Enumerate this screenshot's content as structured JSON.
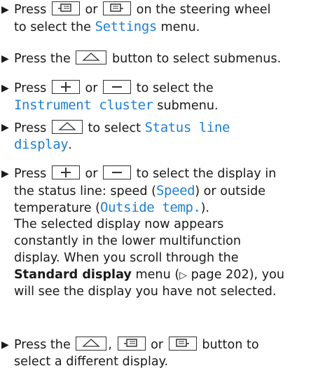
{
  "steps": [
    {
      "lines": [
        [
          "Press ",
          "",
          " or ",
          "",
          " on the steering wheel"
        ],
        [
          "to select the ",
          "Settings",
          " menu."
        ]
      ]
    },
    {
      "lines": [
        [
          "Press the ",
          "",
          " button to select submenus."
        ]
      ]
    },
    {
      "lines": [
        [
          "Press ",
          "",
          " or ",
          "",
          " to select the"
        ],
        [
          "Instrument cluster",
          " submenu."
        ]
      ]
    },
    {
      "lines": [
        [
          "Press ",
          "",
          " to select ",
          "Status line"
        ],
        [
          "display",
          "."
        ]
      ]
    },
    {
      "lines": [
        [
          "Press ",
          "",
          " or ",
          "",
          " to select the display in"
        ],
        [
          "the status line: speed (",
          "Speed",
          ") or outside"
        ],
        [
          "temperature (",
          "Outside temp.",
          ")."
        ],
        [
          "The selected display now appears"
        ],
        [
          "constantly in the lower multifunction"
        ],
        [
          "display. When you scroll through the"
        ],
        [
          "Standard display",
          " menu (",
          "▷",
          " page 202), you"
        ],
        [
          "will see the display you have not selected."
        ]
      ]
    },
    {
      "lines": [
        [
          "Press the ",
          "",
          ", ",
          "",
          " or ",
          "",
          " button to"
        ],
        [
          "select a different display."
        ]
      ]
    }
  ],
  "icons": {
    "bullet": "triangle-right-bullet-icon",
    "back_key": "back-arrow-key-icon",
    "plus_key": "plus-key-icon",
    "minus_key": "minus-key-icon",
    "display_left_key": "display-page-left-key-icon",
    "display_right_key": "display-page-right-key-icon",
    "page_ref": "page-reference-triangle-icon"
  },
  "colors": {
    "menu_text": "#1e7fd2",
    "body_text": "#1a1a1a"
  }
}
